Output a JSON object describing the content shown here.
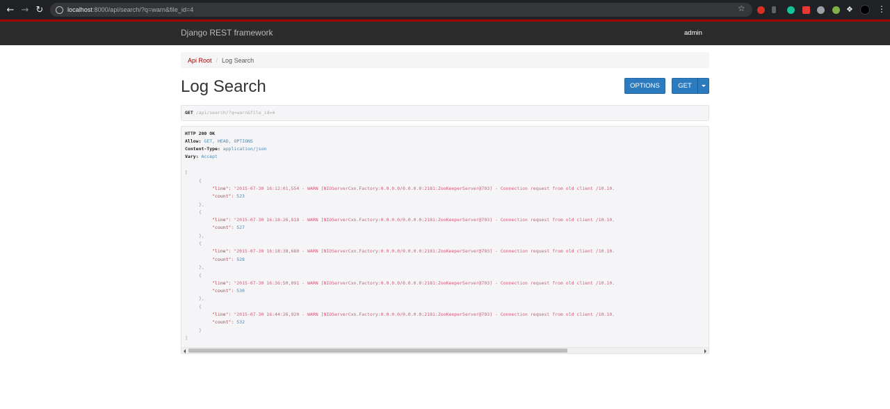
{
  "browser": {
    "url_host": "localhost",
    "url_rest": ":8000/api/search/?q=warn&file_id=4"
  },
  "navbar": {
    "brand": "Django REST framework",
    "user": "admin"
  },
  "breadcrumb": {
    "root": "Api Root",
    "separator": "/",
    "current": "Log Search"
  },
  "page": {
    "title": "Log Search"
  },
  "buttons": {
    "options": "OPTIONS",
    "get": "GET"
  },
  "request": {
    "method": "GET",
    "path": "/api/search/?q=warn&file_id=4"
  },
  "response": {
    "status": "HTTP 200 OK",
    "headers": [
      {
        "key": "Allow:",
        "value": "GET, HEAD, OPTIONS"
      },
      {
        "key": "Content-Type:",
        "value": "application/json"
      },
      {
        "key": "Vary:",
        "value": "Accept"
      }
    ],
    "open_bracket": "[",
    "close_bracket": "]",
    "open_brace": "{",
    "close_brace": "},",
    "last_close_brace": "}",
    "line_key": "\"line\":",
    "count_key": "\"count\":",
    "results": [
      {
        "line": "\"2015-07-30 16:12:01,554 - WARN  [NIOServerCxn.Factory:0.0.0.0/0.0.0.0:2181:ZooKeeperServer@793] - Connection request from old client /10.10.",
        "count": "523"
      },
      {
        "line": "\"2015-07-30 16:18:26,818 - WARN  [NIOServerCxn.Factory:0.0.0.0/0.0.0.0:2181:ZooKeeperServer@793] - Connection request from old client /10.10.",
        "count": "527"
      },
      {
        "line": "\"2015-07-30 16:18:38,680 - WARN  [NIOServerCxn.Factory:0.0.0.0/0.0.0.0:2181:ZooKeeperServer@793] - Connection request from old client /10.10.",
        "count": "528"
      },
      {
        "line": "\"2015-07-30 16:36:50,091 - WARN  [NIOServerCxn.Factory:0.0.0.0/0.0.0.0:2181:ZooKeeperServer@793] - Connection request from old client /10.10.",
        "count": "530"
      },
      {
        "line": "\"2015-07-30 16:44:26,920 - WARN  [NIOServerCxn.Factory:0.0.0.0/0.0.0.0:2181:ZooKeeperServer@793] - Connection request from old client /10.10.",
        "count": "532"
      }
    ]
  },
  "colors": {
    "navbar_bg": "#2c2c2c",
    "navbar_accent": "#a30000",
    "button_bg": "#2c7bbf",
    "link": "#a30000"
  },
  "icons": [
    "back-icon",
    "forward-icon",
    "reload-icon",
    "info-icon",
    "star-icon",
    "puzzle-icon",
    "menu-icon"
  ]
}
